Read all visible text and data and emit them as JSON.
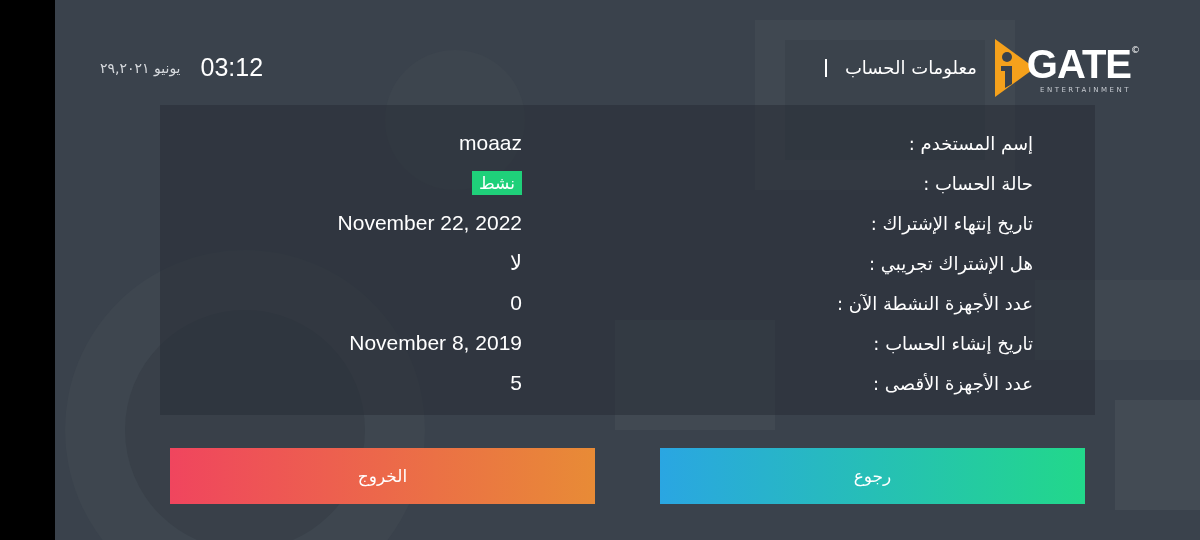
{
  "header": {
    "logo": {
      "wordmark": "GATE",
      "tagline": "ENTERTAINMENT",
      "mark": "©"
    },
    "title": "معلومات الحساب",
    "time": "03:12",
    "date": "يونيو ٢٩,٢٠٢١"
  },
  "account": [
    {
      "label": "إسم المستخدم :",
      "value": "moaaz",
      "kind": "text"
    },
    {
      "label": "حالة الحساب :",
      "value": "نشط",
      "kind": "badge"
    },
    {
      "label": "تاريخ إنتهاء الإشتراك :",
      "value": "November 22, 2022",
      "kind": "text"
    },
    {
      "label": "هل الإشتراك تجريبي :",
      "value": "لا",
      "kind": "text"
    },
    {
      "label": "عدد الأجهزة النشطة الآن :",
      "value": "0",
      "kind": "text"
    },
    {
      "label": "تاريخ إنشاء الحساب :",
      "value": "November 8, 2019",
      "kind": "text"
    },
    {
      "label": "عدد الأجهزة الأقصى :",
      "value": "5",
      "kind": "text"
    }
  ],
  "buttons": [
    {
      "label": "رجوع",
      "kind": "back"
    },
    {
      "label": "الخروج",
      "kind": "exit"
    }
  ]
}
